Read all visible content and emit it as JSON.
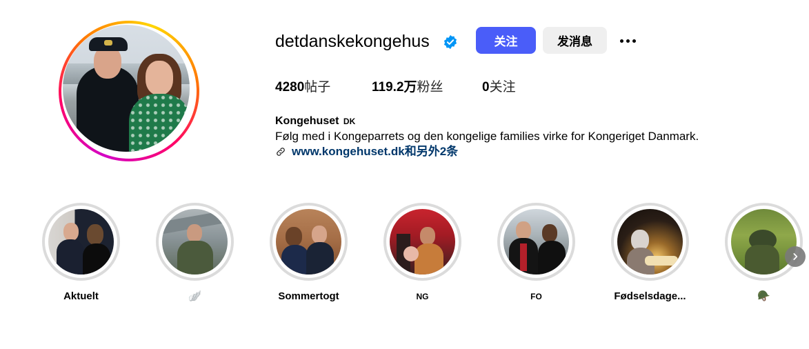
{
  "profile": {
    "username": "detdanskekongehus",
    "verified": true,
    "follow_label": "关注",
    "message_label": "发消息",
    "more_icon": "more-horizontal-icon"
  },
  "stats": {
    "posts_value": "4280",
    "posts_label": "帖子",
    "followers_value": "119.2万",
    "followers_label": "粉丝",
    "following_value": "0",
    "following_label": "关注"
  },
  "bio": {
    "full_name": "Kongehuset",
    "full_name_suffix": "DK",
    "text": "Følg med i Kongeparrets og den kongelige families virke for Kongeriget Danmark.",
    "link_text": "www.kongehuset.dk和另外2条"
  },
  "highlights": [
    {
      "label": "Aktuelt"
    },
    {
      "label": "🪽"
    },
    {
      "label": "Sommertogt"
    },
    {
      "label": "NG"
    },
    {
      "label": "FO"
    },
    {
      "label": "Fødselsdage..."
    },
    {
      "label": "🪖"
    }
  ],
  "colors": {
    "follow_button": "#4a5df9",
    "link": "#00376b",
    "verified": "#0095f6"
  }
}
